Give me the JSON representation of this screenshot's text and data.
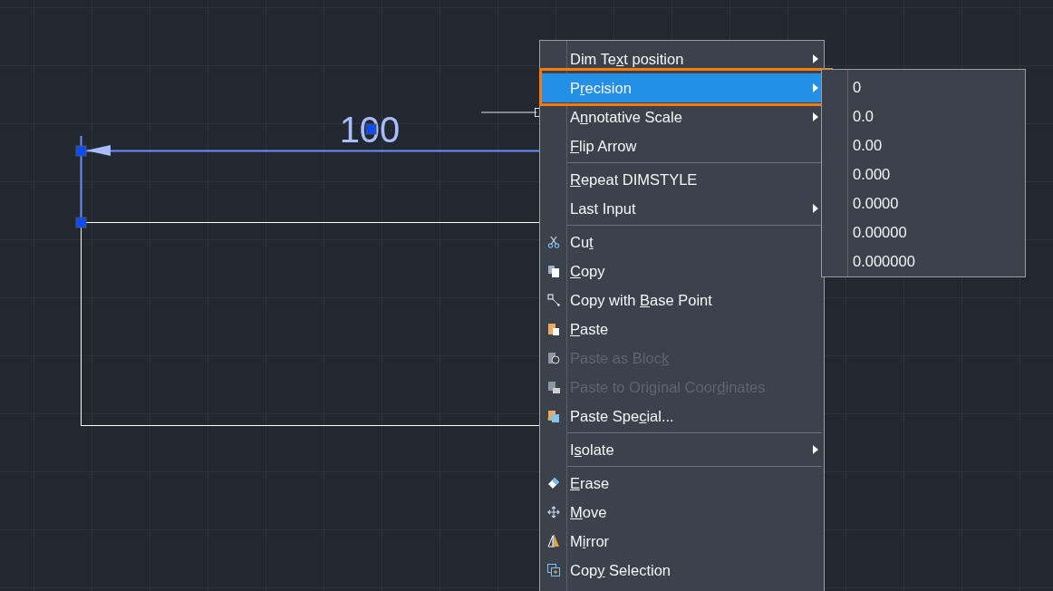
{
  "drawing": {
    "dimension_text": "100"
  },
  "context_menu": {
    "items": [
      {
        "kind": "item",
        "text_before": "Dim Te",
        "accel": "x",
        "text_after": "t position",
        "submenu": true,
        "disabled": false,
        "selected": false
      },
      {
        "kind": "item",
        "text_before": "P",
        "accel": "r",
        "text_after": "ecision",
        "submenu": true,
        "disabled": false,
        "selected": true
      },
      {
        "kind": "item",
        "text_before": "A",
        "accel": "n",
        "text_after": "notative Scale",
        "submenu": true,
        "disabled": false,
        "selected": false
      },
      {
        "kind": "item",
        "accel": "F",
        "text_after": "lip Arrow",
        "submenu": false,
        "disabled": false,
        "selected": false
      },
      {
        "kind": "separator"
      },
      {
        "kind": "item",
        "accel": "R",
        "text_after": "epeat DIMSTYLE",
        "submenu": false,
        "disabled": false,
        "selected": false
      },
      {
        "kind": "item",
        "text_before": "Last Input",
        "submenu": true,
        "disabled": false,
        "selected": false
      },
      {
        "kind": "separator"
      },
      {
        "kind": "item",
        "text_before": "Cu",
        "accel": "t",
        "submenu": false,
        "disabled": false,
        "selected": false
      },
      {
        "kind": "item",
        "accel": "C",
        "text_after": "opy",
        "submenu": false,
        "disabled": false,
        "selected": false
      },
      {
        "kind": "item",
        "text_before": "Copy with ",
        "accel": "B",
        "text_after": "ase Point",
        "submenu": false,
        "disabled": false,
        "selected": false
      },
      {
        "kind": "item",
        "accel": "P",
        "text_after": "aste",
        "submenu": false,
        "disabled": false,
        "selected": false
      },
      {
        "kind": "item",
        "text_before": "Paste as Bloc",
        "accel": "k",
        "submenu": false,
        "disabled": true,
        "selected": false
      },
      {
        "kind": "item",
        "text_before": "Paste to Original Coor",
        "accel": "d",
        "text_after": "inates",
        "submenu": false,
        "disabled": true,
        "selected": false
      },
      {
        "kind": "item",
        "text_before": "Paste Spe",
        "accel": "c",
        "text_after": "ial...",
        "submenu": false,
        "disabled": false,
        "selected": false
      },
      {
        "kind": "separator"
      },
      {
        "kind": "item",
        "text_before": "I",
        "accel": "s",
        "text_after": "olate",
        "submenu": true,
        "disabled": false,
        "selected": false
      },
      {
        "kind": "separator"
      },
      {
        "kind": "item",
        "accel": "E",
        "text_after": "rase",
        "submenu": false,
        "disabled": false,
        "selected": false
      },
      {
        "kind": "item",
        "accel": "M",
        "text_after": "ove",
        "submenu": false,
        "disabled": false,
        "selected": false
      },
      {
        "kind": "item",
        "text_before": "M",
        "accel": "i",
        "text_after": "rror",
        "submenu": false,
        "disabled": false,
        "selected": false
      },
      {
        "kind": "item",
        "text_before": "Cop",
        "accel": "y",
        "text_after": " Selection",
        "submenu": false,
        "disabled": false,
        "selected": false
      }
    ]
  },
  "precision_submenu": {
    "items": [
      "0",
      "0.0",
      "0.00",
      "0.000",
      "0.0000",
      "0.00000",
      "0.000000"
    ]
  }
}
